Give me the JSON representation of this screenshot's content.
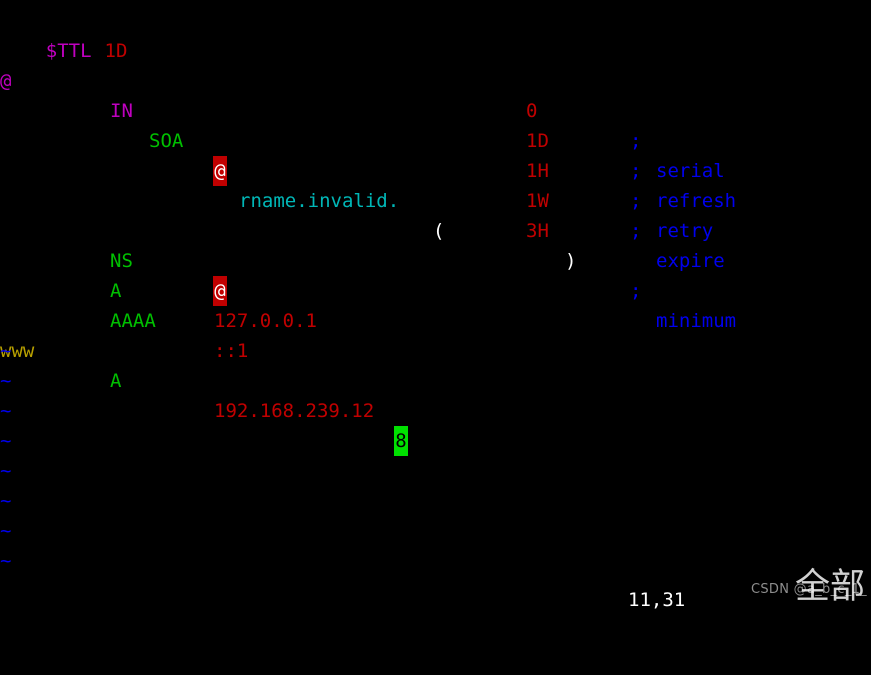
{
  "app": {
    "name": "vim",
    "mode": "normal",
    "background": "#000000"
  },
  "palette": {
    "directive": "#c000c0",
    "magenta": "#c000c0",
    "green": "#00c000",
    "cyan": "#00b7b7",
    "white": "#ffffff",
    "red": "#c00000",
    "blue": "#0000ee",
    "yellow": "#b8a000",
    "cursor_bg": "#00e000",
    "highlight_bg": "#c00000"
  },
  "buffer": {
    "line1": {
      "directive": "$TTL",
      "value": "1D"
    },
    "line2": {
      "owner": "@",
      "class": "IN",
      "type": "SOA",
      "mname": "@",
      "rname": "rname.invalid.",
      "open_paren": "("
    },
    "soa_values": [
      {
        "value": "0",
        "semicolon": ";",
        "comment": "serial"
      },
      {
        "value": "1D",
        "semicolon": ";",
        "comment": "refresh"
      },
      {
        "value": "1H",
        "semicolon": ";",
        "comment": "retry"
      },
      {
        "value": "1W",
        "semicolon": ";",
        "comment": "expire"
      },
      {
        "value": "3H",
        "close_paren": ")",
        "semicolon": ";",
        "comment": "minimum"
      }
    ],
    "records": [
      {
        "owner": "",
        "type": "NS",
        "value": "@",
        "value_highlighted": true,
        "cursor_on_last": false
      },
      {
        "owner": "",
        "type": "A",
        "value": "127.0.0.1",
        "value_highlighted": false,
        "cursor_on_last": false
      },
      {
        "owner": "",
        "type": "AAAA",
        "value": "::1",
        "value_highlighted": false,
        "cursor_on_last": false
      },
      {
        "owner": "www",
        "type": "A",
        "value": "192.168.239.128",
        "value_highlighted": false,
        "cursor_on_last": true
      }
    ],
    "empty_line_marker": "~",
    "empty_line_count": 8
  },
  "statusline": {
    "ruler": "11,31"
  },
  "watermark": {
    "text": "CSDN @a_b_c_1_",
    "cjk": "全部"
  }
}
